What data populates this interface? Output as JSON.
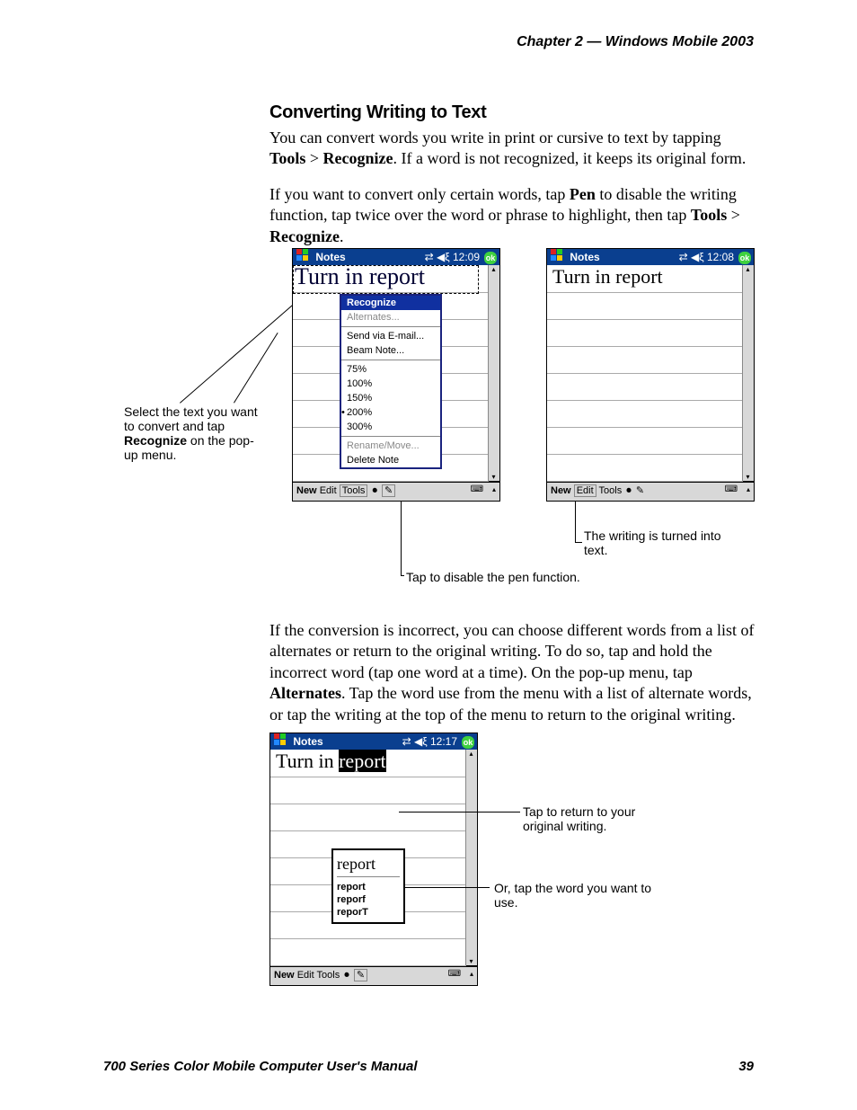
{
  "running_head": "Chapter  2  —    Windows Mobile 2003",
  "heading": "Converting Writing to Text",
  "para1_a": "You can convert words you write in print or cursive to text by tapping ",
  "para1_b": "Tools",
  "para1_c": " > ",
  "para1_d": "Recognize",
  "para1_e": ". If a word is not recognized, it keeps its original form.",
  "para2_a": "If you want to convert only certain words, tap ",
  "para2_b": "Pen",
  "para2_c": " to disable the writing function, tap twice over the word or phrase to highlight, then tap ",
  "para2_d": "Tools",
  "para2_e": " > ",
  "para2_f": "Recognize",
  "para2_g": ".",
  "callout1_a": "Select the text you want to convert and tap ",
  "callout1_b": "Recognize",
  "callout1_c": " on the pop-up menu.",
  "callout2": "The writing is turned into text.",
  "callout3": "Tap to disable the pen function.",
  "device1": {
    "title": "Notes",
    "time": "12:09",
    "written": "Turn   in  report",
    "menu": {
      "recognize": "Recognize",
      "alternates": "Alternates...",
      "send_email": "Send via E-mail...",
      "beam": "Beam Note...",
      "z75": "75%",
      "z100": "100%",
      "z150": "150%",
      "z200": "200%",
      "z300": "300%",
      "rename": "Rename/Move...",
      "delete": "Delete Note"
    },
    "footer": {
      "new": "New",
      "edit": "Edit",
      "tools": "Tools"
    }
  },
  "device2": {
    "title": "Notes",
    "time": "12:08",
    "text": "Turn in report",
    "footer": {
      "new": "New",
      "edit": "Edit",
      "tools": "Tools"
    }
  },
  "para3_a": "If the conversion is incorrect, you can choose different words from a list of alternates or return to the original writing. To do so, tap and hold the incorrect word (tap one word at a time). On the pop-up menu, tap ",
  "para3_b": "Alternates",
  "para3_c": ". Tap the word use from the menu with a list of alternate words, or tap the writing at the top of the menu to return to the original writing.",
  "device3": {
    "title": "Notes",
    "time": "12:17",
    "text_a": "Turn in ",
    "text_b": "report",
    "alts": {
      "hw": "report",
      "a1": "report",
      "a2": "reporf",
      "a3": "reporT"
    },
    "footer": {
      "new": "New",
      "edit": "Edit",
      "tools": "Tools"
    }
  },
  "callout4": "Tap to return to your original writing.",
  "callout5": "Or, tap the word you want to use.",
  "footer_title": "700 Series Color Mobile Computer User's Manual",
  "footer_page": "39"
}
